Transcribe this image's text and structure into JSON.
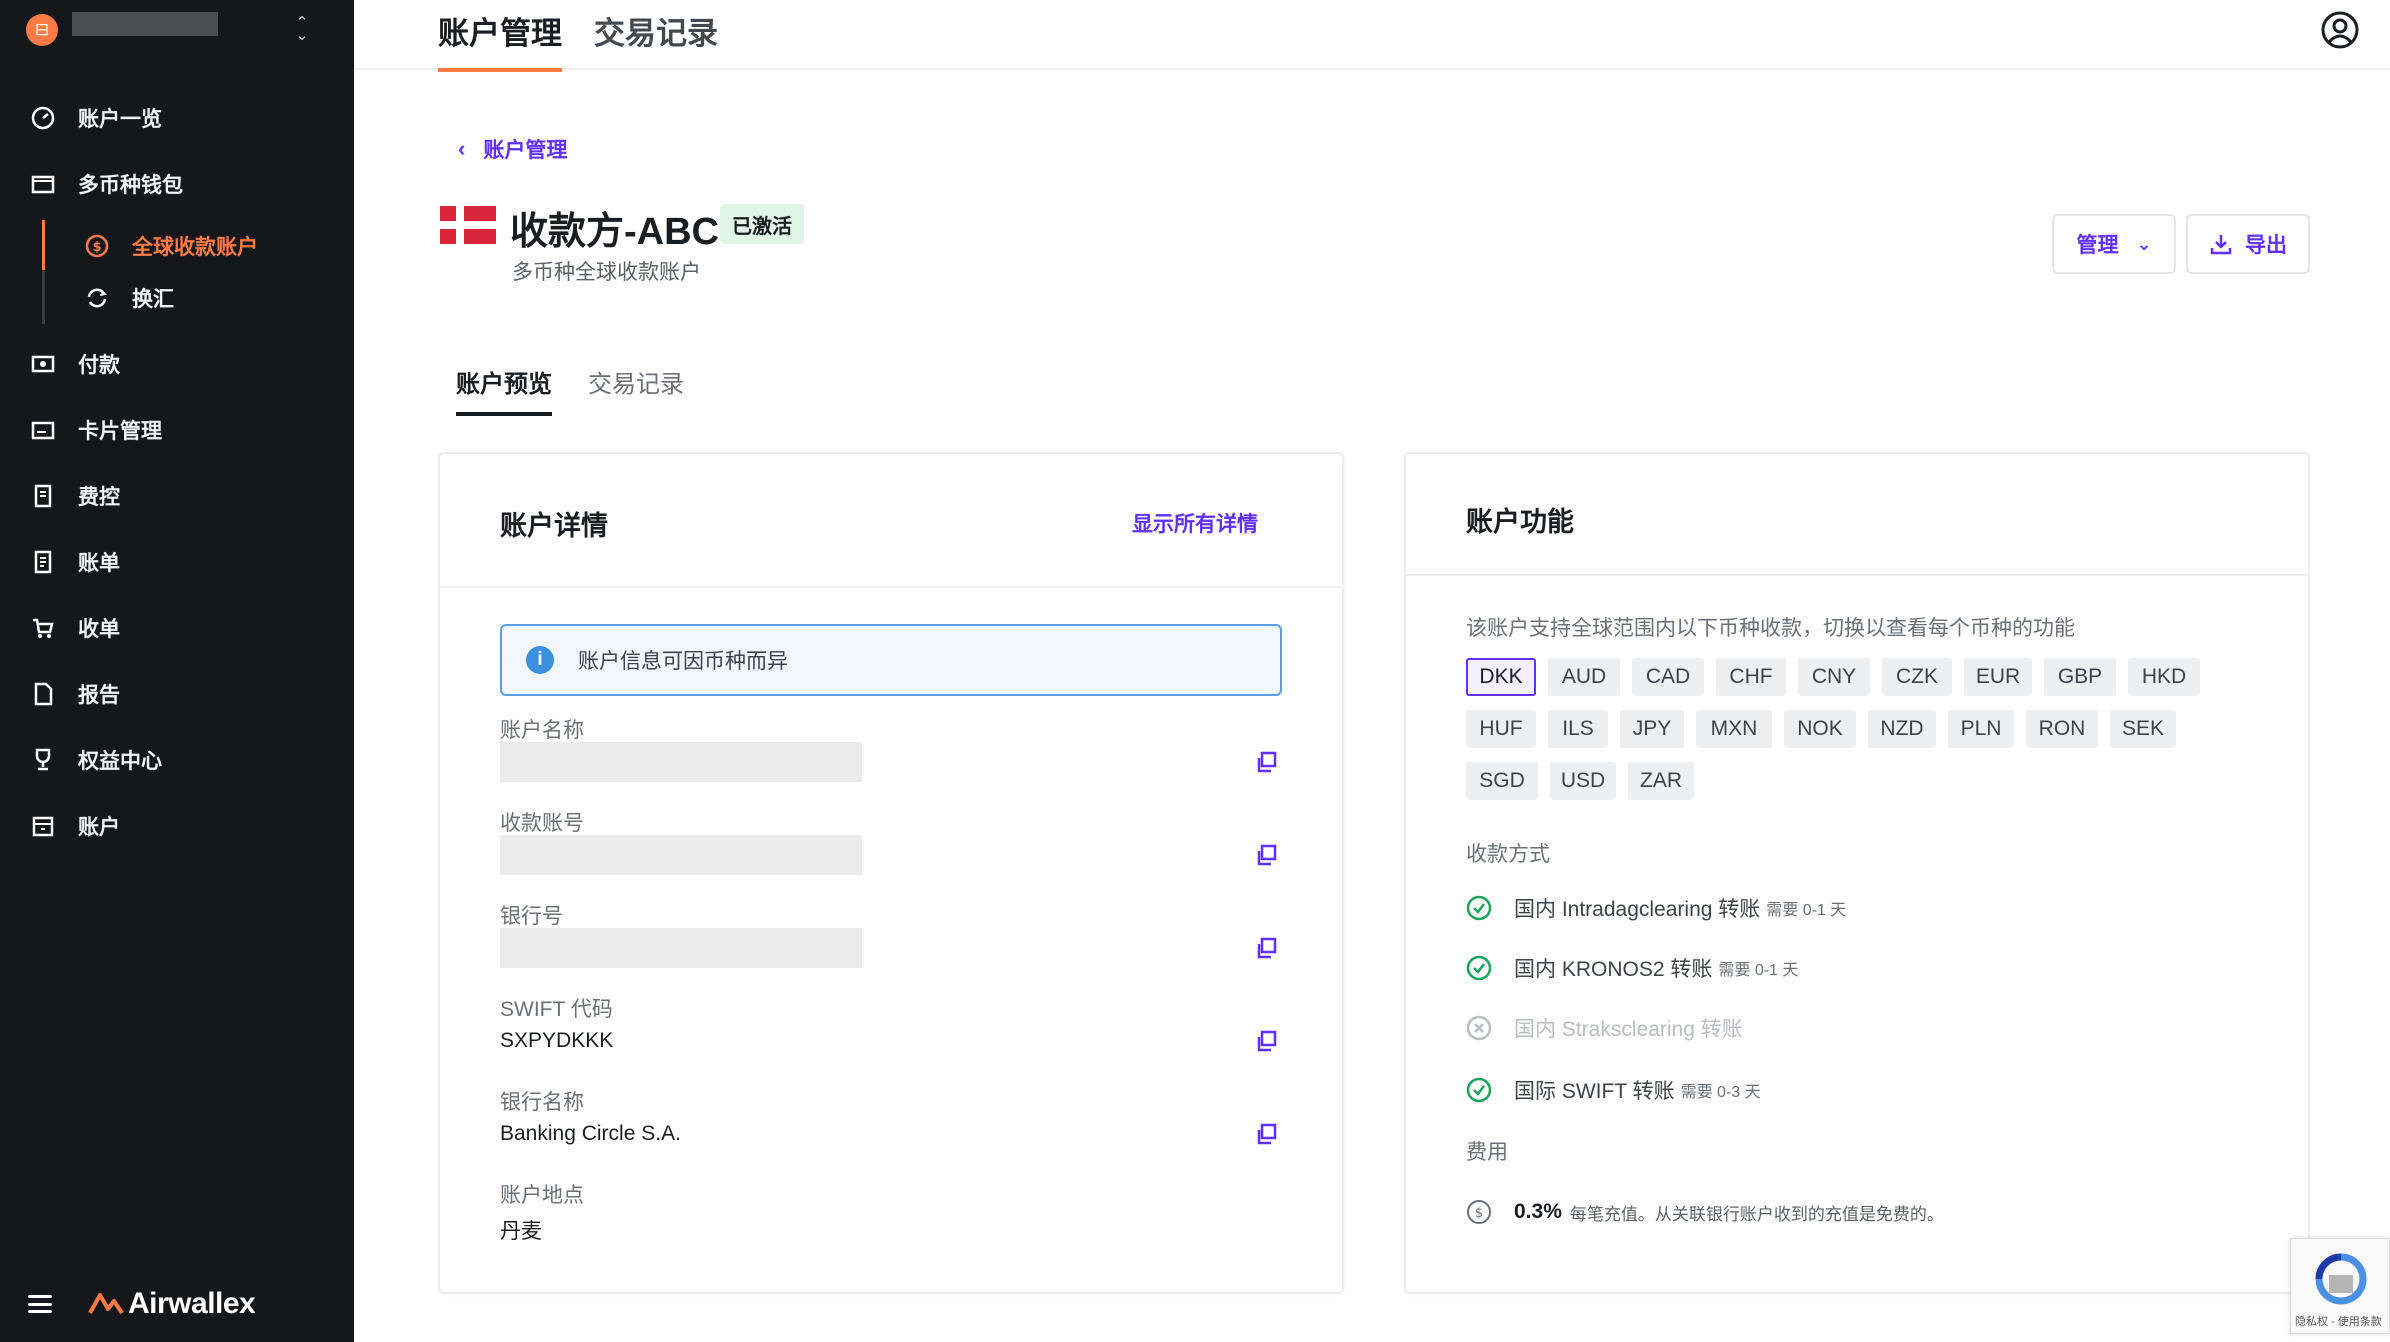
{
  "sidebar": {
    "org_name": "",
    "items": [
      {
        "label": "账户一览",
        "icon": "dashboard-icon"
      },
      {
        "label": "多币种钱包",
        "icon": "wallet-icon"
      },
      {
        "label": "付款",
        "icon": "payout-icon"
      },
      {
        "label": "卡片管理",
        "icon": "card-icon"
      },
      {
        "label": "费控",
        "icon": "expense-icon"
      },
      {
        "label": "账单",
        "icon": "bill-icon"
      },
      {
        "label": "收单",
        "icon": "cart-icon"
      },
      {
        "label": "报告",
        "icon": "report-icon"
      },
      {
        "label": "权益中心",
        "icon": "trophy-icon"
      },
      {
        "label": "账户",
        "icon": "store-icon"
      }
    ],
    "sub_items": [
      {
        "label": "全球收款账户",
        "active": true
      },
      {
        "label": "换汇",
        "active": false
      }
    ],
    "logo_text": "Airwallex",
    "accent_color": "#ff7a45"
  },
  "topbar": {
    "tabs": [
      {
        "label": "账户管理",
        "active": true
      },
      {
        "label": "交易记录",
        "active": false
      }
    ]
  },
  "account": {
    "back_label": "账户管理",
    "title": "收款方-ABC",
    "status": "已激活",
    "subtitle": "多币种全球收款账户",
    "manage_label": "管理",
    "export_label": "导出",
    "tabs": [
      {
        "label": "账户预览",
        "active": true
      },
      {
        "label": "交易记录",
        "active": false
      }
    ]
  },
  "details": {
    "title": "账户详情",
    "show_all": "显示所有详情",
    "info": "账户信息可因币种而异",
    "fields": [
      {
        "label": "账户名称",
        "value": ""
      },
      {
        "label": "收款账号",
        "value": ""
      },
      {
        "label": "银行号",
        "value": ""
      },
      {
        "label": "SWIFT 代码",
        "value": "SXPYDKKK"
      },
      {
        "label": "银行名称",
        "value": "Banking Circle S.A."
      },
      {
        "label": "账户地点",
        "value": "丹麦"
      }
    ]
  },
  "features": {
    "title": "账户功能",
    "description": "该账户支持全球范围内以下币种收款，切换以查看每个币种的功能",
    "currencies": [
      "DKK",
      "AUD",
      "CAD",
      "CHF",
      "CNY",
      "CZK",
      "EUR",
      "GBP",
      "HKD",
      "HUF",
      "ILS",
      "JPY",
      "MXN",
      "NOK",
      "NZD",
      "PLN",
      "RON",
      "SEK",
      "SGD",
      "USD",
      "ZAR"
    ],
    "selected_currency": "DKK",
    "methods_label": "收款方式",
    "methods": [
      {
        "name": "国内 Intradagclearing 转账",
        "note": "需要 0-1 天",
        "enabled": true
      },
      {
        "name": "国内 KRONOS2 转账",
        "note": "需要 0-1 天",
        "enabled": true
      },
      {
        "name": "国内 Straksclearing 转账",
        "note": "",
        "enabled": false
      },
      {
        "name": "国际 SWIFT 转账",
        "note": "需要 0-3 天",
        "enabled": true
      }
    ],
    "fee_label": "费用",
    "fee_value": "0.3%",
    "fee_desc": "每笔充值。从关联银行账户收到的充值是免费的。"
  },
  "recaptcha": {
    "text": "隐私权 - 使用条款"
  }
}
